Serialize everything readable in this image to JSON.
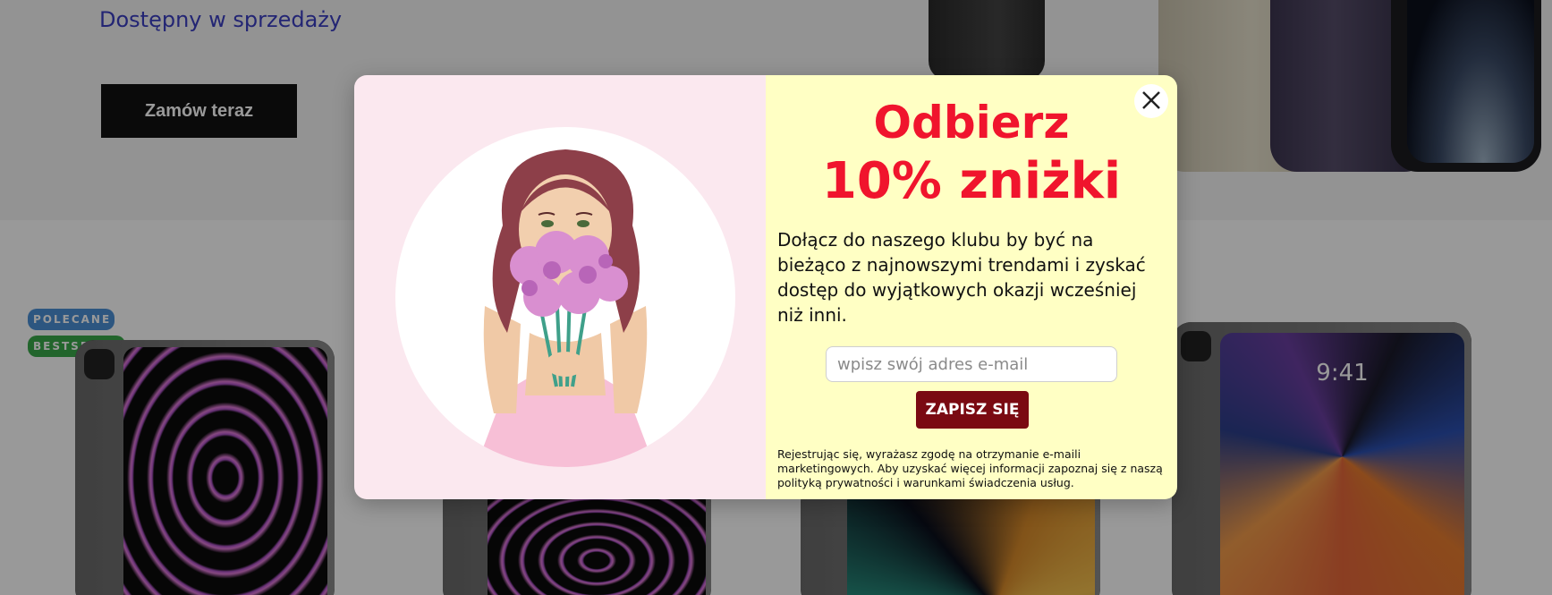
{
  "hero": {
    "subtitle": "Dostępny w sprzedaży",
    "order_button": "Zamów teraz"
  },
  "badges": {
    "recommended": "POLECANE",
    "bestseller": "BESTSELLER"
  },
  "product_screen": {
    "clock": "9:41"
  },
  "modal": {
    "headline_line1": "Odbierz",
    "headline_line2": "10% zniżki",
    "description": "Dołącz do naszego klubu by być na bieżąco z najnowszymi trendami i zyskać dostęp do wyjątkowych okazji wcześniej niż inni.",
    "email_placeholder": "wpisz swój adres e-mail",
    "submit_label": "ZAPISZ SIĘ",
    "legal_text": "Rejestrując się, wyrażasz zgodę na otrzymanie e-maili marketingowych. Aby uzyskać więcej informacji zapoznaj się z naszą polityką prywatności i warunkami świadczenia usług.",
    "close_icon": "close-icon",
    "illustration": "woman-with-flowers-illustration"
  },
  "colors": {
    "headline": "#f0142d",
    "submit_bg": "#7a0a12",
    "modal_left_bg": "#fbe8ef",
    "modal_right_bg": "#ffffc4",
    "hero_subtitle": "#3b3fc1",
    "badge_recommended": "#4b8fd6",
    "badge_bestseller": "#3aa84a"
  }
}
